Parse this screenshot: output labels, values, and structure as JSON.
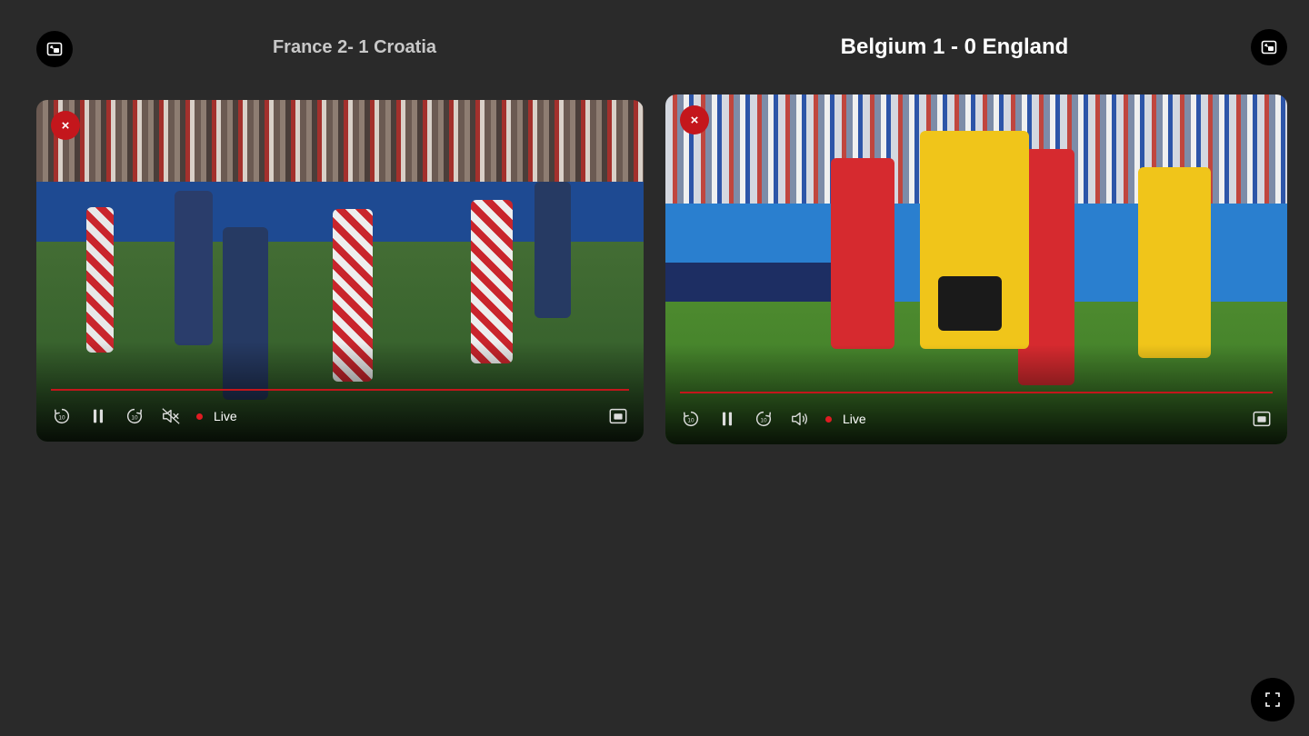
{
  "left_stream": {
    "title": "France 2- 1 Croatia",
    "status": "Live",
    "progress": 1.0
  },
  "right_stream": {
    "title": "Belgium 1 - 0 England",
    "status": "Live",
    "progress": 1.0
  },
  "close_glyph": "×",
  "colors": {
    "background": "#2a2a2a",
    "accent": "#c4161c",
    "live": "#e01b22"
  },
  "icons": {
    "layout": "picture-in-picture-layout-icon",
    "close": "close-icon",
    "rewind": "rewind-10-icon",
    "pause": "pause-icon",
    "forward": "forward-10-icon",
    "mute": "volume-muted-icon",
    "volume": "volume-icon",
    "pip": "mini-player-icon",
    "fullscreen": "fullscreen-icon"
  }
}
